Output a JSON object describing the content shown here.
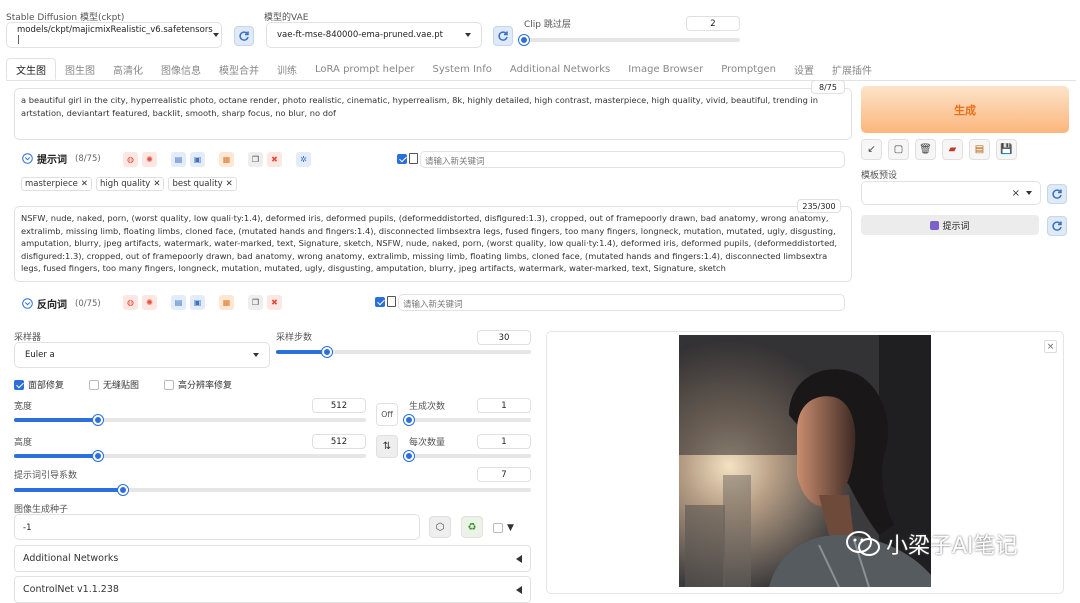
{
  "header": {
    "model_label": "Stable Diffusion 模型(ckpt)",
    "model_value": "models/ckpt/majicmixRealistic_v6.safetensors |",
    "vae_label": "模型的VAE",
    "vae_value": "vae-ft-mse-840000-ema-pruned.vae.pt",
    "clip_label": "Clip 跳过层",
    "clip_value": "2",
    "clip_fraction": 0.0
  },
  "tabs": [
    "文生图",
    "图生图",
    "高清化",
    "图像信息",
    "模型合并",
    "训练",
    "LoRA prompt helper",
    "System Info",
    "Additional Networks",
    "Image Browser",
    "Promptgen",
    "设置",
    "扩展插件"
  ],
  "positive": {
    "counter": "8/75",
    "text": "a  beautiful girl  in the  city, hyperrealistic photo, octane render, photo realistic, cinematic, hyperrealism, 8k, highly detailed, high contrast, masterpiece, high quality, vivid, beautiful, trending in artstation, deviantart featured, backlit, smooth, sharp focus, no blur, no dof",
    "title": "提示词",
    "count": "(8/75)",
    "keyword_placeholder": "请输入新关键词",
    "chips": [
      "masterpiece",
      "high quality",
      "best quality"
    ]
  },
  "negative": {
    "counter": "235/300",
    "text": "NSFW, nude, naked, porn, (worst quality, low quali·ty:1.4), deformed iris, deformed pupils, (deformeddistorted, disfigured:1.3), cropped, out of framepoorly drawn, bad anatomy, wrong anatomy, extralimb, missing limb, floating limbs, cloned face, (mutated hands and fingers:1.4), disconnected limbsextra legs, fused fingers, too many fingers, longneck, mutation, mutated, ugly, disgusting, amputation, blurry, jpeg artifacts, watermark, water-marked, text, Signature, sketch, NSFW, nude, naked, porn, (worst quality, low quali·ty:1.4), deformed iris, deformed pupils, (deformeddistorted, disfigured:1.3), cropped, out of framepoorly drawn, bad anatomy, wrong anatomy, extralimb, missing limb, floating limbs, cloned face, (mutated hands and fingers:1.4), disconnected limbsextra legs, fused fingers, too many fingers, longneck, mutation, mutated, ugly, disgusting, amputation, blurry, jpeg artifacts, watermark, water-marked, text, Signature, sketch",
    "title": "反向词",
    "count": "(0/75)",
    "keyword_placeholder": "请输入新关键词"
  },
  "right": {
    "generate_label": "生成",
    "template_label": "模板预设",
    "prompt_button": "提示词",
    "clear_symbol": "×"
  },
  "params": {
    "sampler_label": "采样器",
    "sampler_value": "Euler a",
    "steps_label": "采样步数",
    "steps_value": "30",
    "steps_fraction": 0.2,
    "face_restore_label": "面部修复",
    "tiling_label": "无缝贴图",
    "hires_label": "高分辨率修复",
    "width_label": "宽度",
    "width_value": "512",
    "width_fraction": 0.24,
    "height_label": "高度",
    "height_value": "512",
    "height_fraction": 0.24,
    "off_label": "Off",
    "swap_label": "⇅",
    "batch_count_label": "生成次数",
    "batch_count_value": "1",
    "batch_count_fraction": 0.0,
    "batch_size_label": "每次数量",
    "batch_size_value": "1",
    "batch_size_fraction": 0.0,
    "cfg_label": "提示词引导系数",
    "cfg_value": "7",
    "cfg_fraction": 0.21,
    "seed_label": "图像生成种子",
    "seed_value": "-1",
    "accordion1": "Additional Networks",
    "accordion2": "ControlNet v1.1.238"
  },
  "output": {
    "close_symbol": "×",
    "watermark": "小梁子AI笔记"
  },
  "colors": {
    "accent": "#2a6fdb",
    "generate_gradient": [
      "#fde3c9",
      "#fbb67c"
    ],
    "generate_text": "#e8701a"
  }
}
